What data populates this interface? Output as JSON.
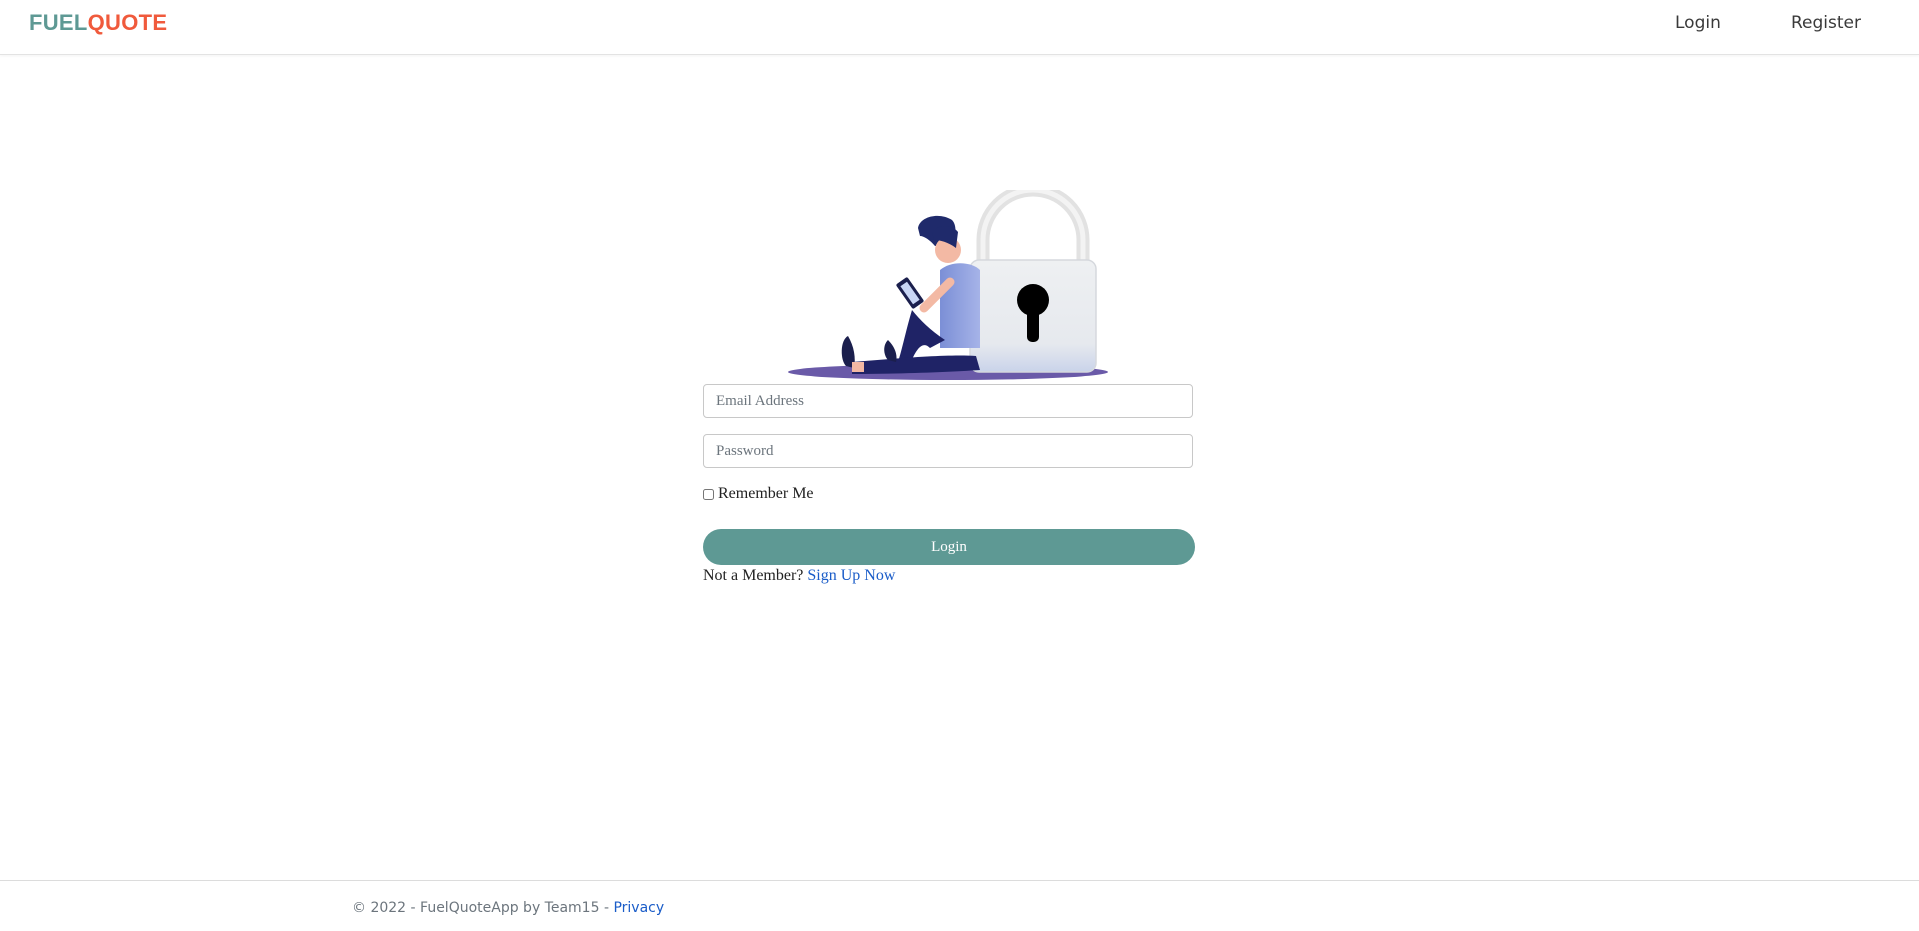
{
  "brand": {
    "part1": "FUEL",
    "part2": "QUOTE",
    "color1": "#5e9994",
    "color2": "#f05a3c"
  },
  "nav": {
    "login": "Login",
    "register": "Register"
  },
  "illustration": {
    "description_icon": "person-with-padlock-illustration"
  },
  "form": {
    "email_placeholder": "Email Address",
    "password_placeholder": "Password",
    "remember_label": "Remember Me",
    "remember_checked": false,
    "login_button": "Login",
    "not_member_text": "Not a Member?",
    "signup_link": "Sign Up Now",
    "accent_color": "#5e9994"
  },
  "footer": {
    "copyright": "© 2022 - FuelQuoteApp by Team15 -",
    "privacy_link": "Privacy"
  }
}
